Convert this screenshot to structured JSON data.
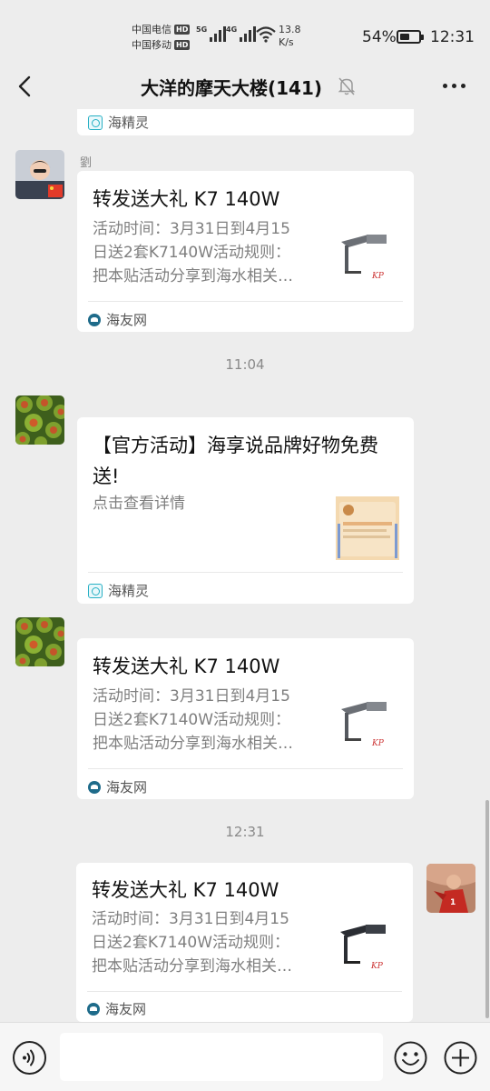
{
  "status_bar": {
    "carrier1": "中国电信",
    "carrier2": "中国移动",
    "hd_badge": "HD",
    "net1": "5G",
    "net2": "4G",
    "speed_value": "13.8",
    "speed_unit": "K/s",
    "battery_pct": "54%",
    "battery_level": 0.54,
    "time": "12:31"
  },
  "nav": {
    "title": "大洋的摩天大楼(141)"
  },
  "messages": [
    {
      "source": "海精灵"
    },
    {
      "sender": "劉",
      "title": "转发送大礼 K7 140W",
      "desc": "活动时间：3月31日到4月15\n日送2套K7140W活动规则：\n把本贴活动分享到海水相关…",
      "source": "海友网"
    },
    {
      "time": "11:04"
    },
    {
      "title": "【官方活动】海享说品牌好物免费送!",
      "desc": "点击查看详情",
      "source": "海精灵"
    },
    {
      "title": "转发送大礼 K7 140W",
      "desc": "活动时间：3月31日到4月15\n日送2套K7140W活动规则：\n把本贴活动分享到海水相关…",
      "source": "海友网"
    },
    {
      "time": "12:31"
    },
    {
      "title": "转发送大礼 K7 140W",
      "desc": "活动时间：3月31日到4月15\n日送2套K7140W活动规则：\n把本贴活动分享到海水相关…",
      "source": "海友网"
    }
  ],
  "colors": {
    "background": "#ededed",
    "card": "#ffffff",
    "secondary_text": "#7f7f7f"
  },
  "input": {
    "value": ""
  },
  "icons": {
    "back": "back-arrow-icon",
    "mute": "bell-muted-icon",
    "more": "more-dots-icon",
    "voice": "voice-icon",
    "emoji": "emoji-icon",
    "plus": "plus-icon"
  }
}
